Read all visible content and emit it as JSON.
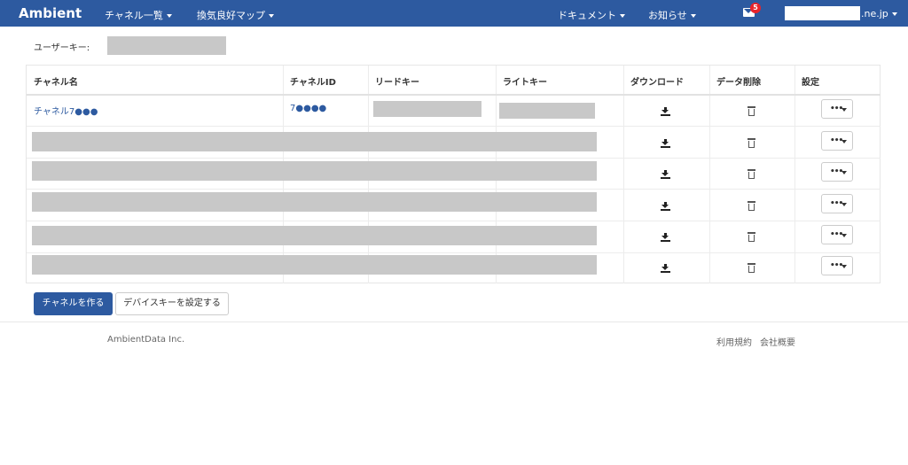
{
  "navbar": {
    "brand": "Ambient",
    "menu": [
      {
        "label": "チャネル一覧"
      },
      {
        "label": "換気良好マップ"
      }
    ],
    "right": [
      {
        "label": "ドキュメント"
      },
      {
        "label": "お知らせ"
      }
    ],
    "mail_badge": "5",
    "account_suffix": ".ne.jp"
  },
  "user_key": {
    "label": "ユーザーキー:"
  },
  "table": {
    "headers": [
      "チャネル名",
      "チャネルID",
      "リードキー",
      "ライトキー",
      "ダウンロード",
      "データ削除",
      "設定"
    ],
    "first_row": {
      "name": "チャネル7●●●",
      "id": "7●●●●"
    },
    "rows": 6
  },
  "actions": {
    "create_channel": "チャネルを作る",
    "set_device_key": "デバイスキーを設定する"
  },
  "footer": {
    "company": "AmbientData Inc.",
    "terms": "利用規約",
    "about": "会社概要"
  },
  "icons": {
    "download": "download-icon",
    "delete": "trash-icon",
    "settings": "ellipsis-icon",
    "mail": "envelope-icon"
  },
  "colors": {
    "navbar": "#2d5aa0",
    "primary_button": "#2d5aa0",
    "badge": "#e8242b",
    "redaction": "#c8c8c8"
  }
}
